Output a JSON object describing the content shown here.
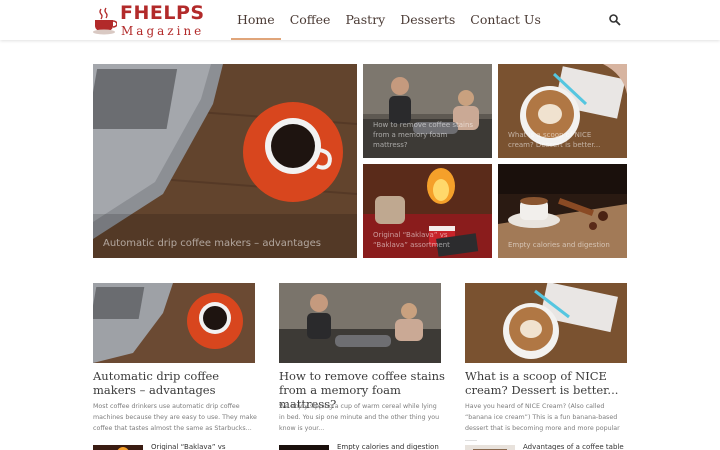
{
  "brand": {
    "name_top": "FHELPS",
    "name_bottom": "Magazine",
    "color": "#b22a2a"
  },
  "nav": {
    "items": [
      {
        "label": "Home",
        "active": true
      },
      {
        "label": "Coffee"
      },
      {
        "label": "Pastry"
      },
      {
        "label": "Desserts"
      },
      {
        "label": "Contact Us"
      }
    ],
    "search_icon": "search-icon"
  },
  "featured": {
    "main": {
      "title": "Automatic drip coffee makers – advantages"
    },
    "tiles": [
      {
        "title": "How to remove coffee stains from a memory foam mattress?"
      },
      {
        "title": "What is a scoop of NICE cream? Dessert is better..."
      },
      {
        "title": "Original “Baklava” vs “Baklava” assortment"
      },
      {
        "title": "Empty calories and digestion"
      }
    ]
  },
  "articles": [
    {
      "title": "Automatic drip coffee makers – advantages",
      "excerpt": "Most coffee drinkers use automatic drip coffee machines because they are easy to use. They make coffee that tastes almost the same as Starbucks..."
    },
    {
      "title": "How to remove coffee stains from a memory foam mattress?",
      "excerpt": "We enjoy sipping a cup of warm cereal while lying in bed. You sip one minute and the other thing you know is your..."
    },
    {
      "title": "What is a scoop of NICE cream? Dessert is better...",
      "excerpt": "Have you heard of NICE Cream? (Also called “banana ice cream”) This is a fun banana-based dessert that is becoming more and more popular ......"
    }
  ],
  "small_list": [
    {
      "title": "Original “Baklava” vs “Baklava”"
    },
    {
      "title": "Empty calories and digestion"
    },
    {
      "title": "Advantages of a coffee table"
    }
  ]
}
